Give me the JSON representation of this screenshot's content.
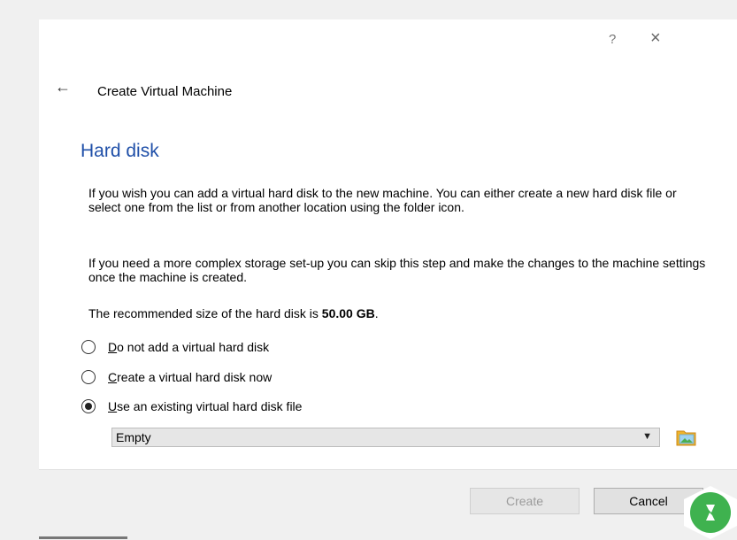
{
  "titlebar": {
    "help_glyph": "?",
    "close_glyph": "×"
  },
  "wizard": {
    "back_glyph": "←",
    "title": "Create Virtual Machine",
    "page_heading": "Hard disk"
  },
  "content": {
    "paragraph1": "If you wish you can add a virtual hard disk to the new machine. You can either create a new hard disk file or select one from the list or from another location using the folder icon.",
    "paragraph2": "If you need a more complex storage set-up you can skip this step and make the changes to the machine settings once the machine is created.",
    "recommended_prefix": "The recommended size of the hard disk is ",
    "recommended_size": "50.00 GB",
    "recommended_suffix": "."
  },
  "options": [
    {
      "mnemonic": "D",
      "rest": "o not add a virtual hard disk",
      "selected": false
    },
    {
      "mnemonic": "C",
      "rest": "reate a virtual hard disk now",
      "selected": false
    },
    {
      "mnemonic": "U",
      "rest": "se an existing virtual hard disk file",
      "selected": true
    }
  ],
  "disk_selector": {
    "value": "Empty",
    "icon": "folder-icon"
  },
  "buttons": {
    "create": "Create",
    "cancel": "Cancel"
  },
  "colors": {
    "heading": "#1f4fa8",
    "badge": "#3fb24f"
  }
}
